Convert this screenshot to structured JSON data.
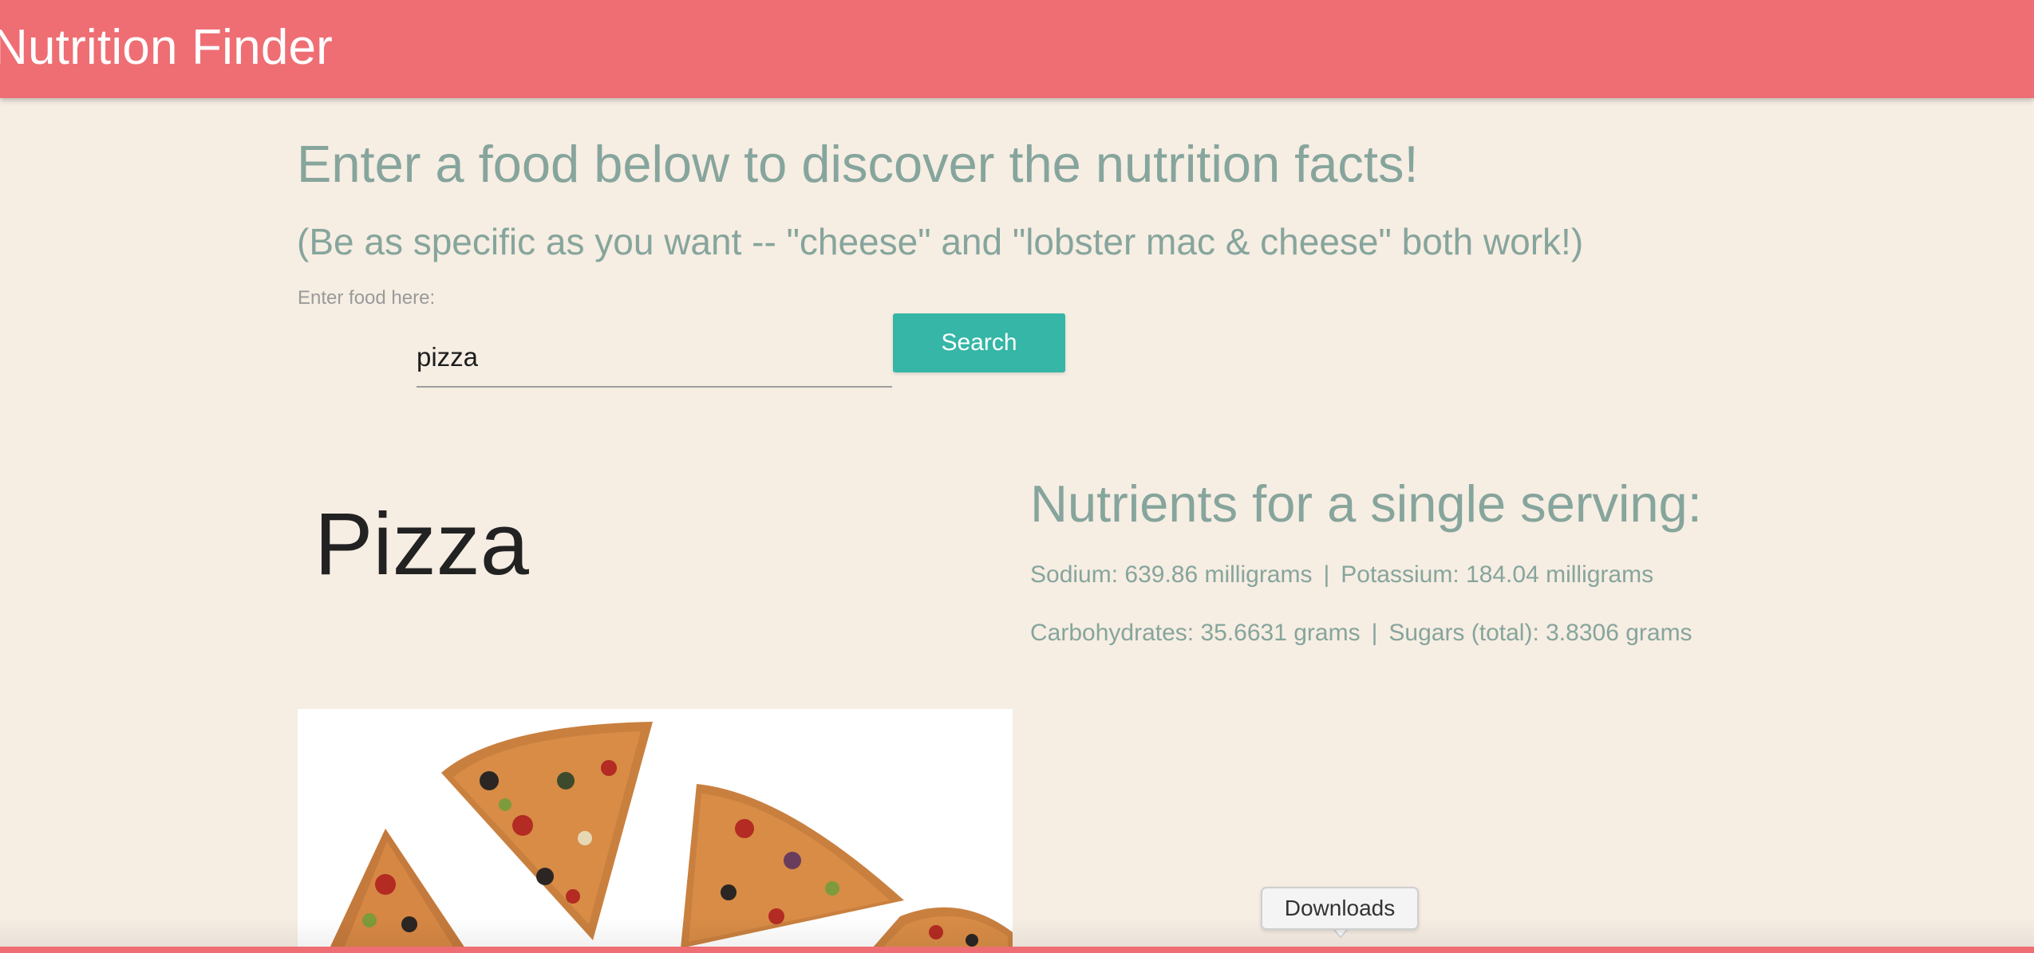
{
  "header": {
    "brand": "Nutrition Finder"
  },
  "intro": {
    "headline": "Enter a food below to discover the nutrition facts!",
    "subheadline": "(Be as specific as you want -- \"cheese\" and \"lobster mac & cheese\" both work!)"
  },
  "search": {
    "label": "Enter food here:",
    "value": "pizza",
    "button_label": "Search"
  },
  "result": {
    "food_name": "Pizza",
    "image_subject": "pizza-slices-image"
  },
  "nutrients": {
    "title": "Nutrients for a single serving:",
    "separator": "|",
    "sodium": "Sodium: 639.86 milligrams",
    "potassium": "Potassium: 184.04 milligrams",
    "carbohydrates": "Carbohydrates: 35.6631 grams",
    "sugars": "Sugars (total): 3.8306 grams"
  },
  "browser": {
    "tooltip": "Downloads"
  },
  "colors": {
    "header": "#ee6e74",
    "background": "#f6ede3",
    "accent_text": "#86a59c",
    "button": "#35b6a6"
  }
}
